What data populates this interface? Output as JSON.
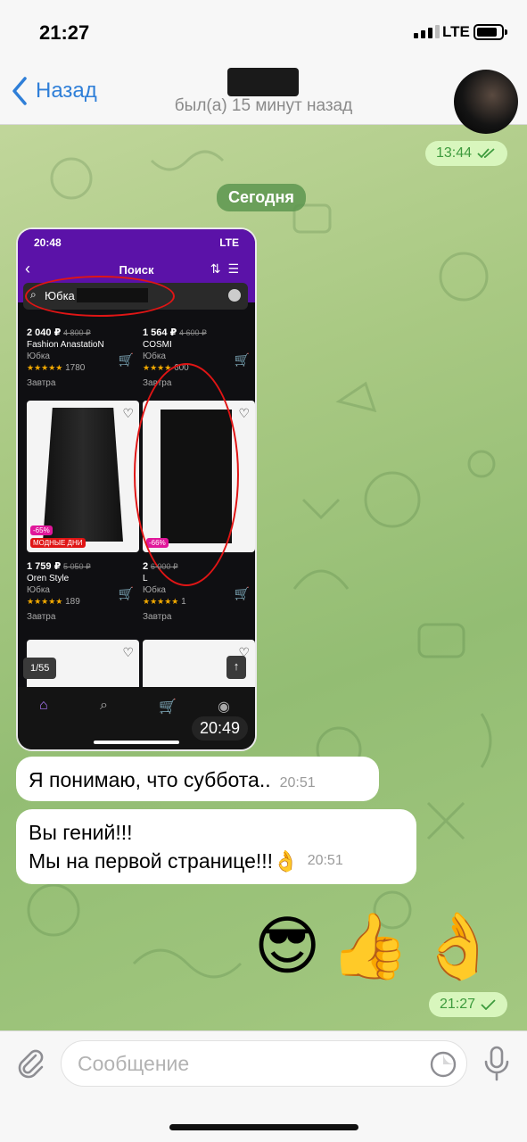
{
  "statusbar": {
    "time": "21:27",
    "network": "LTE"
  },
  "header": {
    "back_label": "Назад",
    "last_seen": "был(а) 15 минут назад"
  },
  "messages": {
    "outgoing_1_time": "13:44",
    "date_chip": "Сегодня",
    "screenshot": {
      "time": "20:49",
      "phone_status_time": "20:48",
      "phone_network": "LTE",
      "screen_title": "Поиск",
      "search_value": "Юбка",
      "products": [
        {
          "price": "2 040 ₽",
          "old_price": "4 800 ₽",
          "brand": "Fashion AnastatioN",
          "category": "Юбка",
          "reviews": "1780",
          "delivery": "Завтра"
        },
        {
          "price": "1 564 ₽",
          "old_price": "4 600 ₽",
          "brand": "COSMI",
          "category": "Юбка",
          "reviews": "600",
          "delivery": "Завтра"
        },
        {
          "price": "1 759 ₽",
          "old_price": "5 050 ₽",
          "brand": "Oren Style",
          "category": "Юбка",
          "reviews": "189",
          "delivery": "Завтра",
          "discount": "-65%",
          "promo": "МОДНЫЕ ДНИ"
        },
        {
          "price": "2",
          "old_price": "6 000 ₽",
          "brand": "L",
          "category": "Юбка",
          "reviews": "1",
          "delivery": "Завтра",
          "discount": "-66%"
        }
      ],
      "page_counter": "1/55"
    },
    "incoming_1": {
      "text": "Я понимаю, что суббота..",
      "time": "20:51"
    },
    "incoming_2": {
      "line1": "Вы гений!!!",
      "line2": "Мы на первой странице!!!👌",
      "time": "20:51"
    },
    "emoji": [
      "😎",
      "👍",
      "👌"
    ],
    "outgoing_2_time": "21:27"
  },
  "composer": {
    "placeholder": "Сообщение"
  },
  "colors": {
    "accent": "#2f7fd8",
    "outgoing_bubble": "#d8f6bd",
    "read_check": "#3d9a3d",
    "app_header": "#5b12a8"
  },
  "icons": [
    "back-chevron-icon",
    "paperclip-icon",
    "sticker-icon",
    "microphone-icon",
    "double-check-icon",
    "single-check-icon"
  ]
}
